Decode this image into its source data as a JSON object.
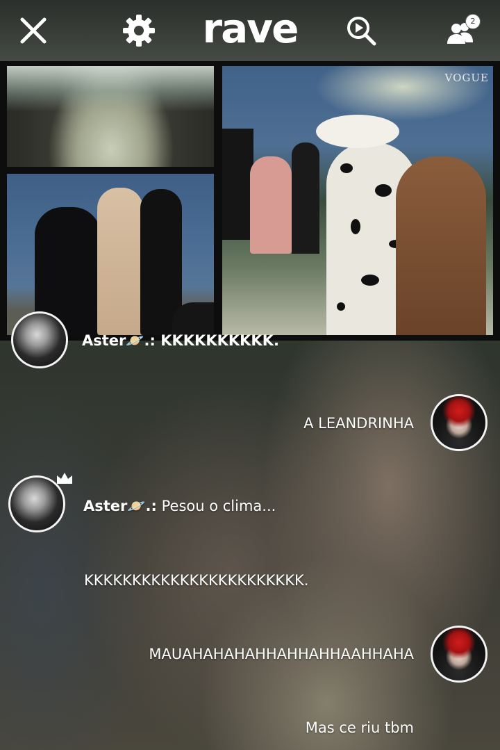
{
  "topbar": {
    "logo": "rave",
    "people_badge_count": "2"
  },
  "video": {
    "watermark": "VOGUE"
  },
  "chat": {
    "messages": [
      {
        "sender": "Aster🪐.:",
        "text": "KKKKKKKKKK.",
        "side": "left",
        "partially_hidden": true
      },
      {
        "sender": "",
        "text": "A LEANDRINHA",
        "side": "right"
      },
      {
        "sender": "Aster🪐.:",
        "text": "Pesou o clima...",
        "side": "left"
      },
      {
        "sender": "",
        "text": "KKKKKKKKKKKKKKKKKKKKKKK.",
        "side": "left"
      },
      {
        "sender": "",
        "text": "MAUAHAHAHAHHAHHAHHAAHHAHA",
        "side": "right"
      },
      {
        "sender": "",
        "text": "Mas ce riu tbm",
        "side": "right"
      }
    ]
  }
}
